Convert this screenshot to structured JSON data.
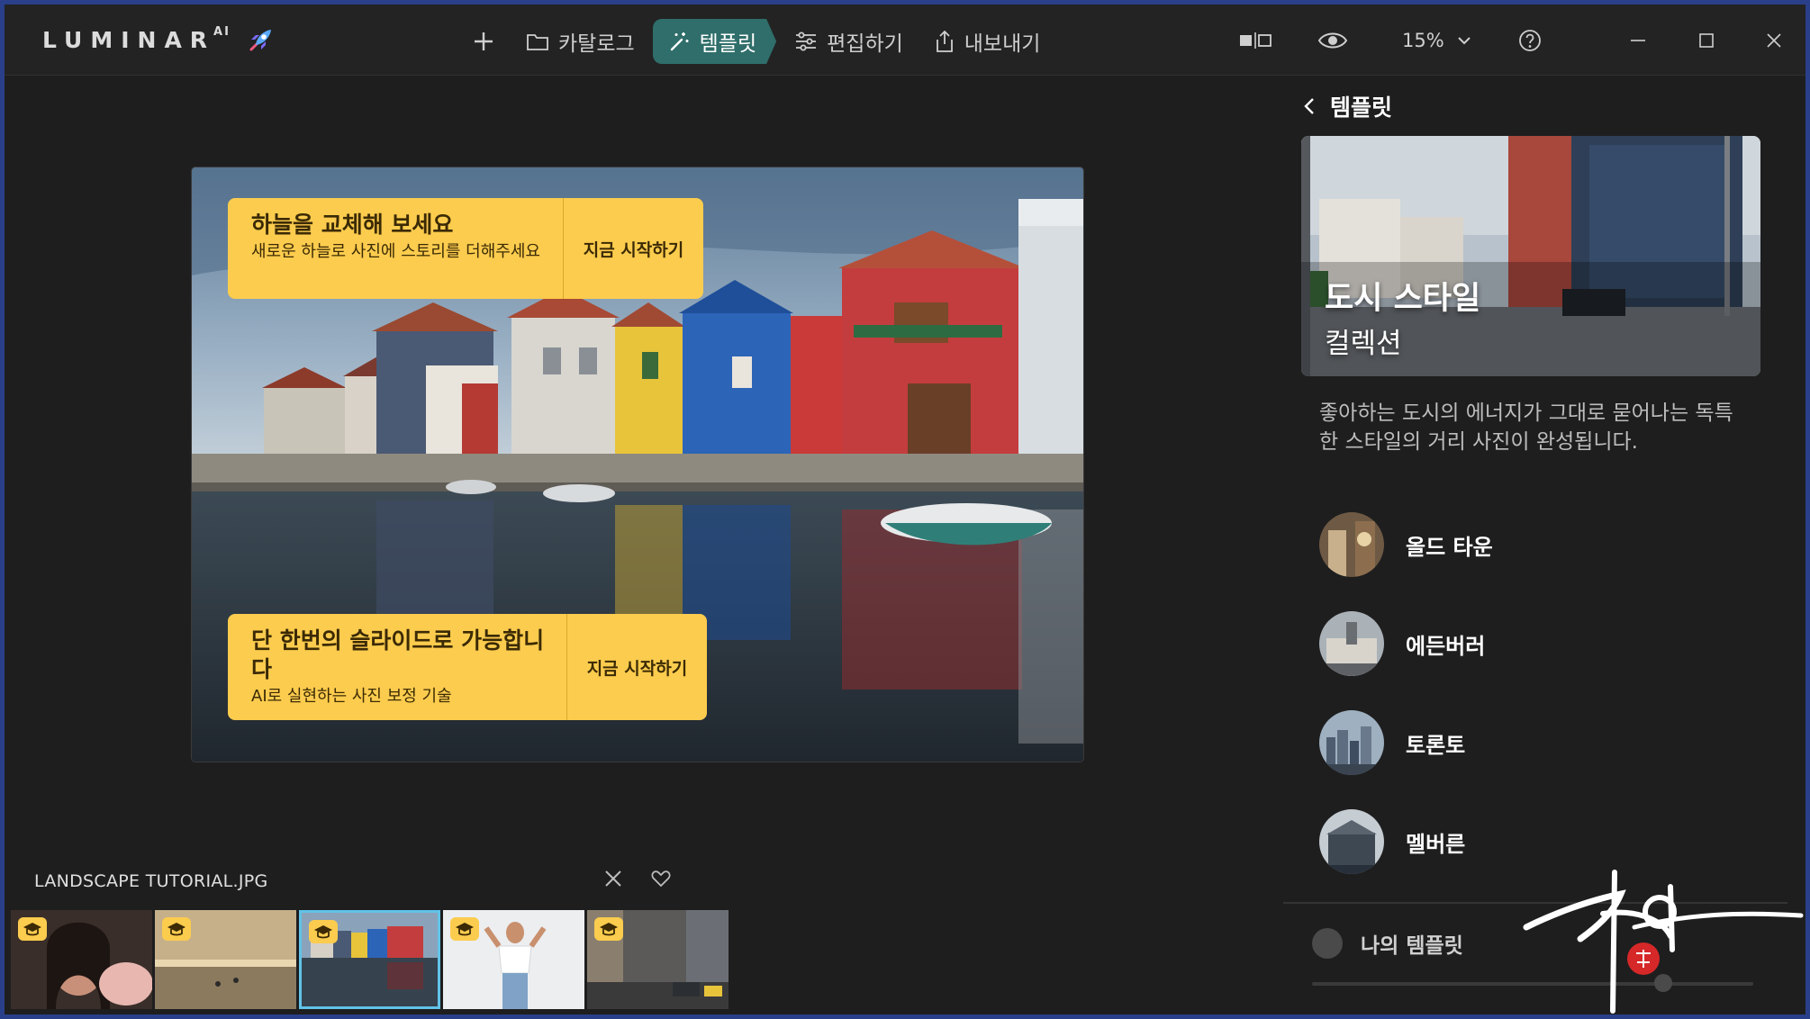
{
  "app": {
    "logo": "LUMINAR",
    "logo_sup": "AI"
  },
  "toolbar": {
    "add_icon": "plus-icon",
    "catalog": "카탈로그",
    "templates": "템플릿",
    "edit": "편집하기",
    "export": "내보내기",
    "zoom": "15%"
  },
  "promos": [
    {
      "title": "하늘을 교체해 보세요",
      "subtitle": "새로운 하늘로 사진에 스토리를 더해주세요",
      "cta": "지금 시작하기"
    },
    {
      "title": "단 한번의 슬라이드로 가능합니다",
      "subtitle": "AI로 실현하는 사진 보정 기술",
      "cta": "지금 시작하기"
    }
  ],
  "filmstrip": {
    "filename": "LANDSCAPE TUTORIAL.JPG",
    "selected_index": 2,
    "count": 5
  },
  "panel": {
    "back_label": "템플릿",
    "collection_title": "도시 스타일",
    "collection_subtitle": "컬렉션",
    "description": "좋아하는 도시의 에너지가 그대로 묻어나는 독특한 스타일의 거리 사진이 완성됩니다.",
    "templates": [
      {
        "name": "올드 타운"
      },
      {
        "name": "에든버러"
      },
      {
        "name": "토론토"
      },
      {
        "name": "멜버른"
      }
    ],
    "my_templates": "나의 템플릿"
  },
  "colors": {
    "accent": "#2f6e6a",
    "promo": "#fccc4e",
    "selection": "#62c3e8"
  }
}
